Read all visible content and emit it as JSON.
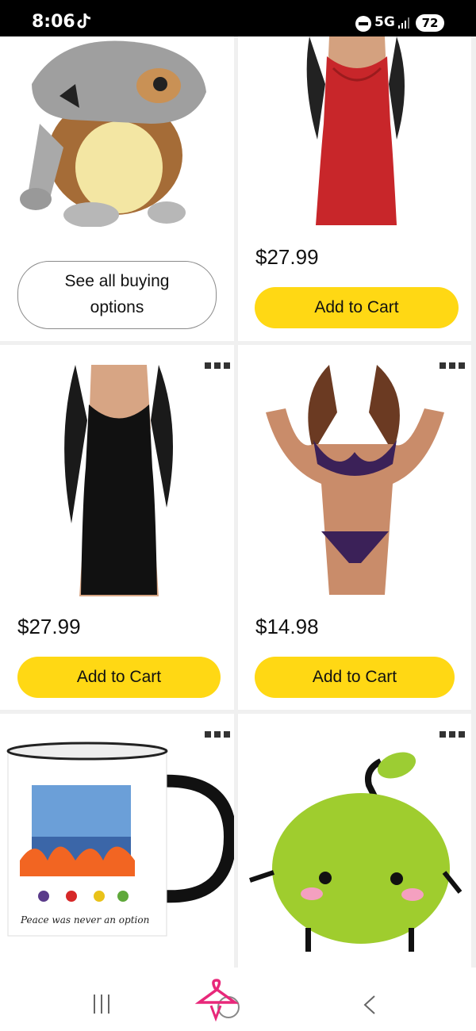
{
  "status_bar": {
    "time": "8:06",
    "network": "5G",
    "battery": "72"
  },
  "products": [
    {
      "button_label": "See all buying options"
    },
    {
      "price": "$27.99",
      "button_label": "Add to Cart"
    },
    {
      "price": "$27.99",
      "button_label": "Add to Cart"
    },
    {
      "price": "$14.98",
      "button_label": "Add to Cart"
    },
    {
      "mug_text": "Peace was never an option"
    },
    {}
  ],
  "colors": {
    "add_to_cart": "#ffd814",
    "home_accent": "#e8287a"
  },
  "icons": [
    "tiktok-icon",
    "dnd-icon",
    "signal-icon",
    "more-options-icon",
    "recents-icon",
    "home-icon",
    "back-icon"
  ]
}
